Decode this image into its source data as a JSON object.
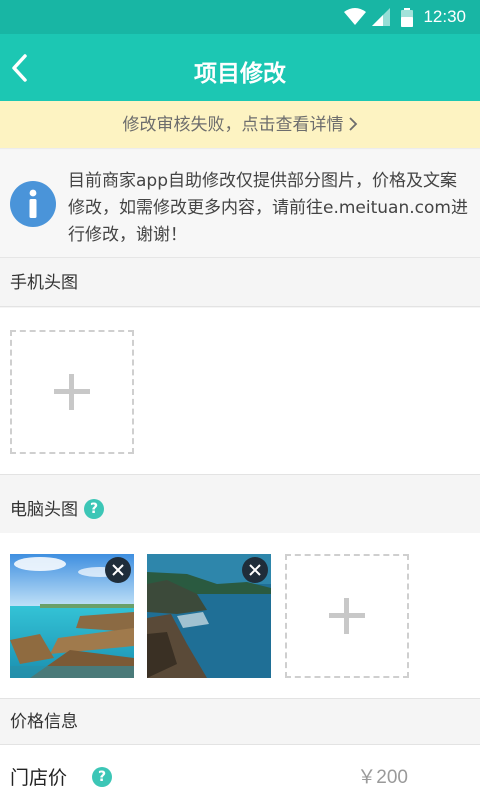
{
  "status_bar": {
    "time": "12:30"
  },
  "header": {
    "title": "项目修改"
  },
  "notice": {
    "text": "修改审核失败，点击查看详情"
  },
  "info": {
    "text": "目前商家app自助修改仅提供部分图片，价格及文案修改，如需修改更多内容，请前往e.meituan.com进行修改，谢谢！"
  },
  "sections": {
    "mobile_header": {
      "title": "手机头图"
    },
    "pc_header": {
      "title": "电脑头图",
      "help": "?"
    },
    "price_info": {
      "title": "价格信息"
    }
  },
  "price": {
    "label": "门店价",
    "help": "?",
    "value": "￥200"
  },
  "colors": {
    "accent": "#1cc7b3",
    "notice_bg": "#fdf3c2",
    "info_icon": "#4a94d9",
    "help_icon": "#3cc6b6"
  }
}
